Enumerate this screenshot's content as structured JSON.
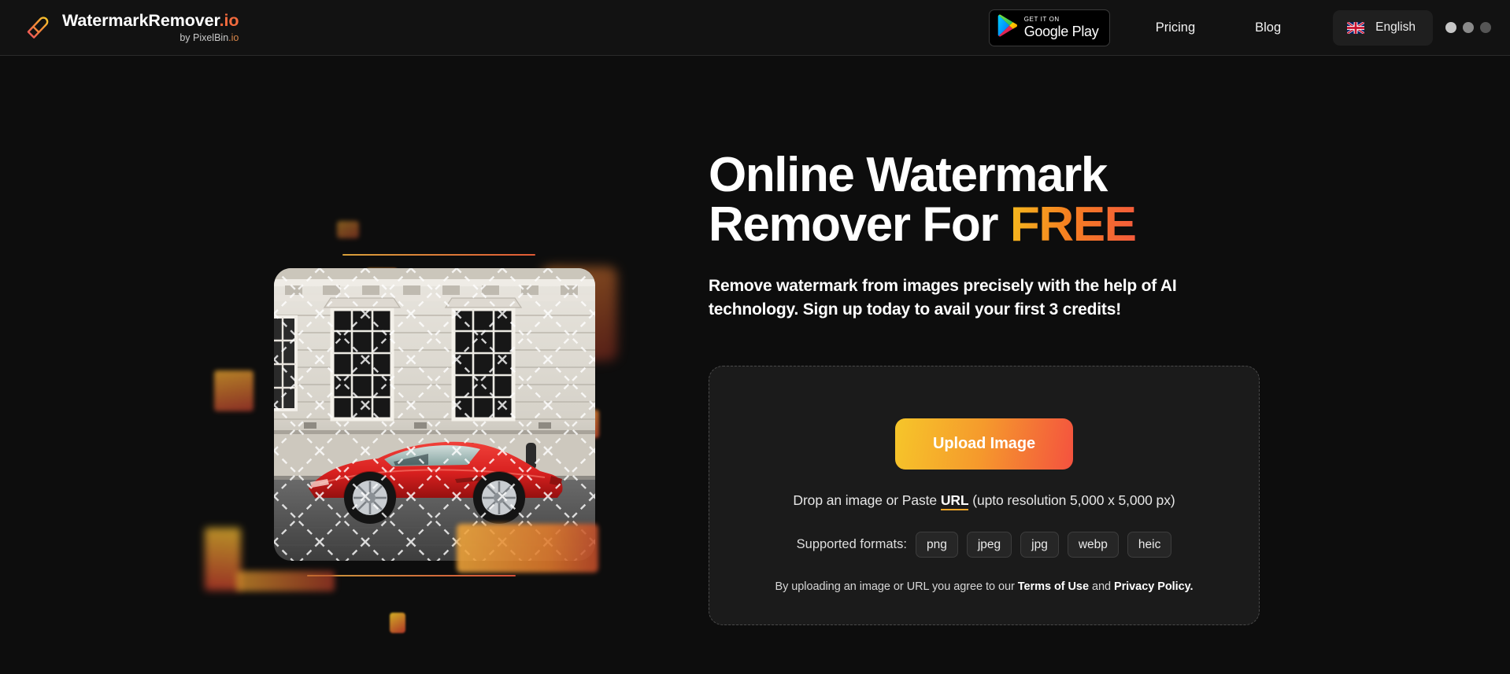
{
  "header": {
    "brand": {
      "name": "WatermarkRemover",
      "tld": ".io",
      "byline_prefix": "by PixelBin",
      "byline_tld": ".io",
      "logo_icon": "eraser-icon"
    },
    "google_play": {
      "small_label": "GET IT ON",
      "big_label": "Google Play",
      "icon": "google-play-icon"
    },
    "nav": [
      {
        "label": "Pricing",
        "name": "nav-link-pricing"
      },
      {
        "label": "Blog",
        "name": "nav-link-blog"
      }
    ],
    "language": {
      "label": "English",
      "flag_icon": "uk-flag-icon"
    },
    "loading_dots": [
      "#c6c6c6",
      "#8a8a8a",
      "#555555"
    ]
  },
  "hero": {
    "headline_line1": "Online Watermark",
    "headline_line2_prefix": "Remover For ",
    "headline_highlight": "FREE",
    "subheadline": "Remove watermark from images precisely with the help of AI technology. Sign up today to avail your first 3 credits!",
    "image_alt": "red-sports-car-watermarked-photo"
  },
  "uploader": {
    "upload_button": "Upload Image",
    "drop_text_before": "Drop an image or Paste ",
    "drop_link": "URL",
    "drop_text_after": " (upto resolution 5,000 x 5,000 px)",
    "formats_label": "Supported formats:",
    "formats": [
      "png",
      "jpeg",
      "jpg",
      "webp",
      "heic"
    ],
    "legal_before": "By uploading an image or URL you agree to our ",
    "legal_terms": "Terms of Use",
    "legal_middle": " and ",
    "legal_privacy": "Privacy Policy.",
    "accent_gradient_start": "#f6c62a",
    "accent_gradient_end": "#f4523f"
  }
}
